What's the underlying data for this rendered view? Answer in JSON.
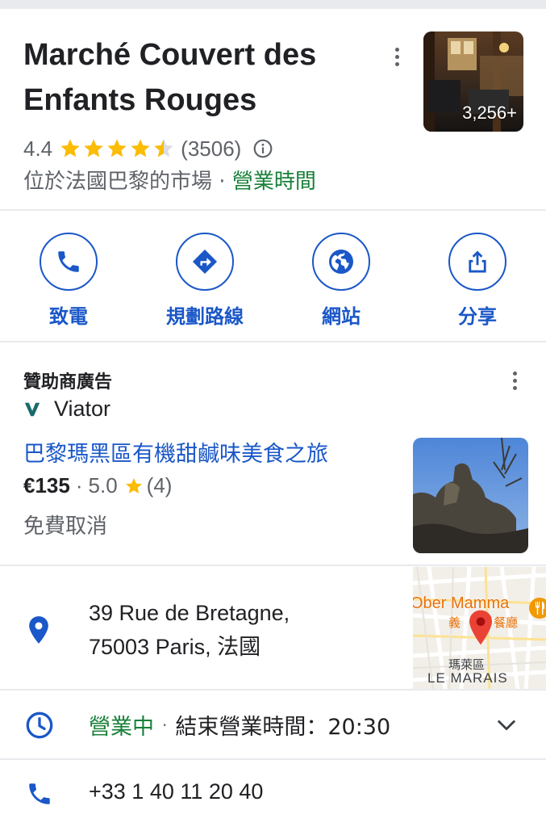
{
  "place": {
    "name_line1": "Marché Couvert des",
    "name_line2": "Enfants Rouges",
    "photo_count": "3,256+",
    "rating": "4.4",
    "review_count": "(3506)",
    "stars_fraction": 0.88,
    "category": "位於法國巴黎的市場",
    "separator": "·",
    "hours_link": "營業時間"
  },
  "actions": [
    {
      "label": "致電",
      "icon": "phone-icon"
    },
    {
      "label": "規劃路線",
      "icon": "directions-icon"
    },
    {
      "label": "網站",
      "icon": "globe-icon"
    },
    {
      "label": "分享",
      "icon": "share-icon"
    }
  ],
  "sponsored": {
    "heading": "贊助商廣告",
    "advertiser": "Viator",
    "title": "巴黎瑪黑區有機甜鹹味美食之旅",
    "price": "€135",
    "separator": "·",
    "rating": "5.0",
    "review_count": "(4)",
    "cancellation": "免費取消"
  },
  "address": {
    "line1": "39 Rue de Bretagne,",
    "line2": "75003 Paris, 法國"
  },
  "map": {
    "restaurant_label": "Ober Mamma",
    "restaurant_sub_1": "義",
    "restaurant_sub_2": "餐廳",
    "district_zh": "瑪萊區",
    "district_fr": "LE MARAIS"
  },
  "hours": {
    "status": "營業中",
    "separator": "·",
    "closing": "結束營業時間：20:30"
  },
  "phone": {
    "number": "+33 1 40 11 20 40"
  },
  "colors": {
    "accent_blue": "#1a57c8",
    "open_green": "#188038",
    "star_yellow": "#fbbc04",
    "viator_green": "#186b6d"
  }
}
